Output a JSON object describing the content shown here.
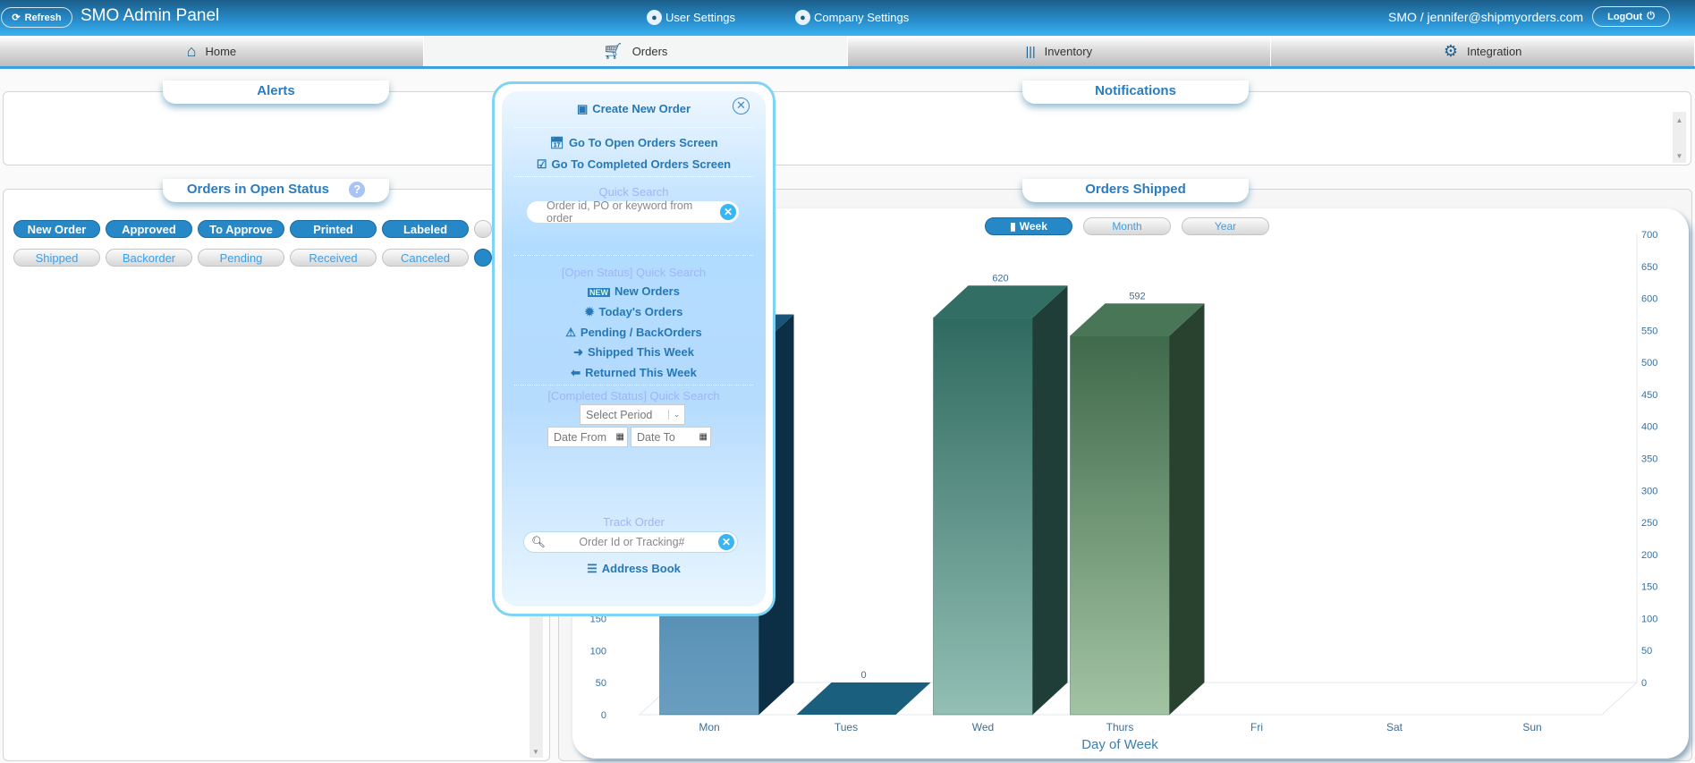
{
  "header": {
    "refresh": "Refresh",
    "title": "SMO Admin Panel",
    "user_settings": "User Settings",
    "company_settings": "Company Settings",
    "user": "SMO / jennifer@shipmyorders.com",
    "logout": "LogOut"
  },
  "nav": [
    {
      "label": "Home",
      "icon": "home-icon"
    },
    {
      "label": "Orders",
      "icon": "cart-icon",
      "active": true
    },
    {
      "label": "Inventory",
      "icon": "barcode-icon"
    },
    {
      "label": "Integration",
      "icon": "gear-icon"
    }
  ],
  "alerts": {
    "title": "Alerts"
  },
  "notifications": {
    "title": "Notifications"
  },
  "open_status": {
    "title": "Orders in Open Status",
    "row1": [
      "New Order",
      "Approved",
      "To Approve",
      "Printed",
      "Labeled"
    ],
    "row2": [
      "Shipped",
      "Backorder",
      "Pending",
      "Received",
      "Canceled"
    ]
  },
  "orders_shipped": {
    "title": "Orders Shipped",
    "periods": [
      "Week",
      "Month",
      "Year"
    ],
    "active_period": "Week"
  },
  "popup": {
    "create": "Create New Order",
    "open_screen": "Go To Open Orders Screen",
    "completed_screen": "Go To Completed Orders Screen",
    "quick_search": "Quick Search",
    "quick_search_placeholder": "Order id, PO or keyword from order",
    "open_qs": "[Open Status] Quick Search",
    "new_orders": "New Orders",
    "new_badge": "NEW",
    "todays": "Today's Orders",
    "pending": "Pending / BackOrders",
    "shipped_week": "Shipped This Week",
    "returned_week": "Returned This Week",
    "completed_qs": "[Completed Status] Quick Search",
    "select_period": "Select Period",
    "date_from": "Date From",
    "date_to": "Date To",
    "track": "Track Order",
    "track_placeholder": "Order Id or Tracking#",
    "address_book": "Address Book"
  },
  "chart_data": {
    "type": "bar",
    "categories": [
      "Mon",
      "Tues",
      "Wed",
      "Thurs",
      "Fri",
      "Sat",
      "Sun"
    ],
    "values": [
      575,
      0,
      620,
      592,
      null,
      null,
      null
    ],
    "data_labels": [
      "",
      "0",
      "620",
      "592",
      "",
      "",
      ""
    ],
    "xlabel": "Day of Week",
    "ylim": [
      0,
      700
    ],
    "yticks": [
      0,
      50,
      100,
      150,
      200,
      250,
      300,
      350,
      400,
      450,
      500,
      550,
      600,
      650,
      700
    ],
    "colors": [
      "#2f7cab",
      "#1b5f7e",
      "#347a6f",
      "#4d7d5a"
    ],
    "grid": false,
    "style": "3d"
  }
}
